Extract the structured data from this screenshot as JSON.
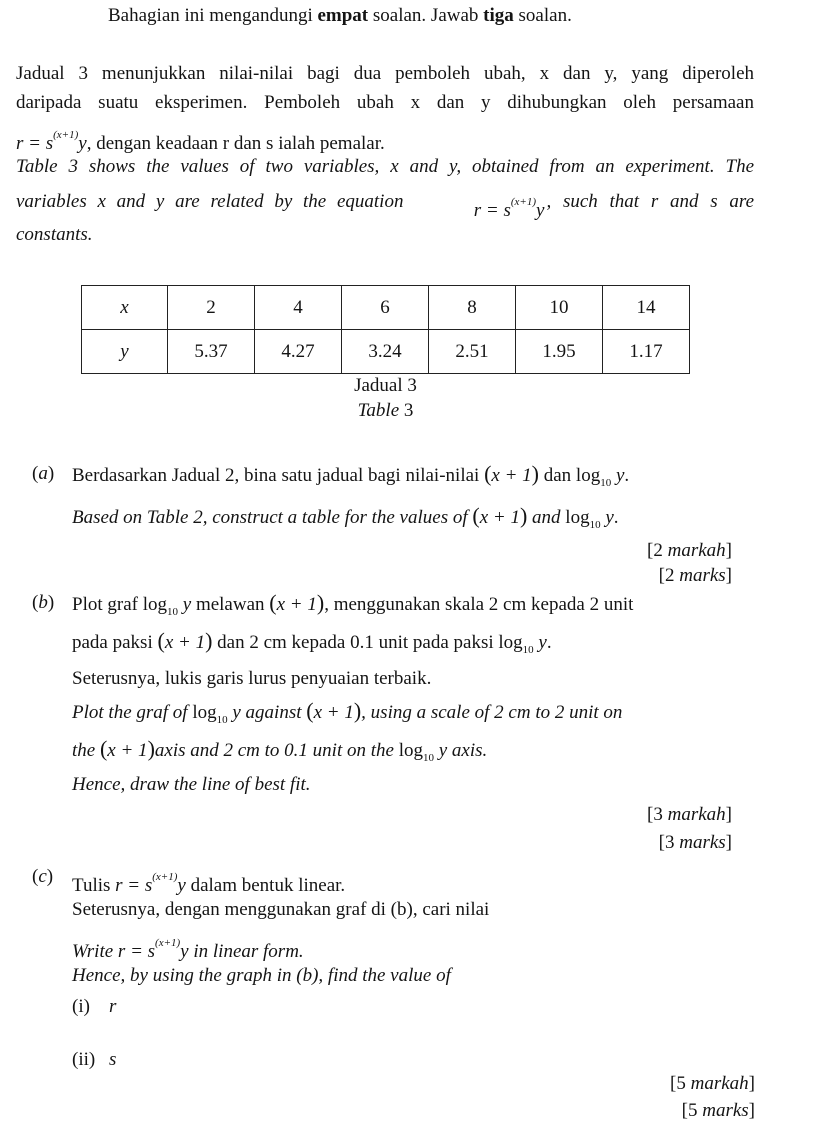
{
  "header": {
    "part1": "Bahagian ini mengandungi ",
    "bold1": "empat",
    "part2": " soalan. Jawab ",
    "bold2": "tiga",
    "part3": " soalan."
  },
  "intro_ms": {
    "line1": "Jadual 3 menunjukkan nilai-nilai bagi dua pemboleh ubah, x dan y, yang diperoleh",
    "line2": "daripada suatu eksperimen. Pemboleh ubah x dan y dihubungkan oleh persamaan",
    "line3_suffix": ", dengan keadaan r dan s ialah pemalar."
  },
  "intro_en": {
    "line1": "Table 3 shows the values of two variables, x and y, obtained from an experiment. The",
    "line2_prefix": "variables x and y are related by the equation",
    "line2_suffix": ", such that r and s are",
    "line3": "constants."
  },
  "equation": {
    "lhs": "r = s",
    "exponent": "(x+1)",
    "rhs": "y"
  },
  "table": {
    "rows": [
      {
        "header": "x",
        "values": [
          "2",
          "4",
          "6",
          "8",
          "10",
          "14"
        ]
      },
      {
        "header": "y",
        "values": [
          "5.37",
          "4.27",
          "3.24",
          "2.51",
          "1.95",
          "1.17"
        ]
      }
    ],
    "caption_ms": "Jadual 3",
    "caption_en_word": "Table",
    "caption_en_num": " 3"
  },
  "part_a": {
    "label": "(a)",
    "ms_prefix": "Berdasarkan Jadual 2, bina satu jadual bagi nilai-nilai",
    "ms_mid": "dan",
    "en_prefix": "Based on Table 2, construct a table for the values of",
    "en_mid": "and",
    "marks_ms": "[2 markah]",
    "marks_en": "[2 marks]"
  },
  "part_b": {
    "label": "(b)",
    "ms_line1_prefix": "Plot graf",
    "ms_line1_mid": "melawan",
    "ms_line1_suffix": ", menggunakan skala 2 cm kepada 2 unit",
    "ms_line2_prefix": "pada paksi",
    "ms_line2_mid": "dan 2 cm kepada 0.1 unit pada paksi",
    "ms_line3": "Seterusnya, lukis garis lurus penyuaian terbaik.",
    "en_line1_prefix": "Plot the graf of",
    "en_line1_mid": "against",
    "en_line1_suffix": ", using a scale of 2 cm to 2 unit on",
    "en_line2_prefix": "the",
    "en_line2_mid": "axis and 2 cm to 0.1 unit on the",
    "en_line2_suffix": "axis.",
    "en_line3": "Hence, draw the line of best fit.",
    "marks_ms": "[3 markah]",
    "marks_en": "[3 marks]"
  },
  "part_c": {
    "label": "(c)",
    "ms_line1_prefix": "Tulis",
    "ms_line1_suffix": "dalam bentuk linear.",
    "ms_line2": "Seterusnya, dengan menggunakan graf di (b), cari nilai",
    "en_line1_prefix": "Write",
    "en_line1_suffix": "in linear form.",
    "en_line2": "Hence, by using the graph in (b), find the value of",
    "sub_i_label": "(i)",
    "sub_i_var": "r",
    "sub_ii_label": "(ii)",
    "sub_ii_var": "s",
    "marks_ms": "[5 markah]",
    "marks_en": "[5 marks]"
  },
  "math": {
    "x_plus_1": "x + 1",
    "log": "log",
    "log_base": "10",
    "log_var": "y",
    "period": "."
  }
}
